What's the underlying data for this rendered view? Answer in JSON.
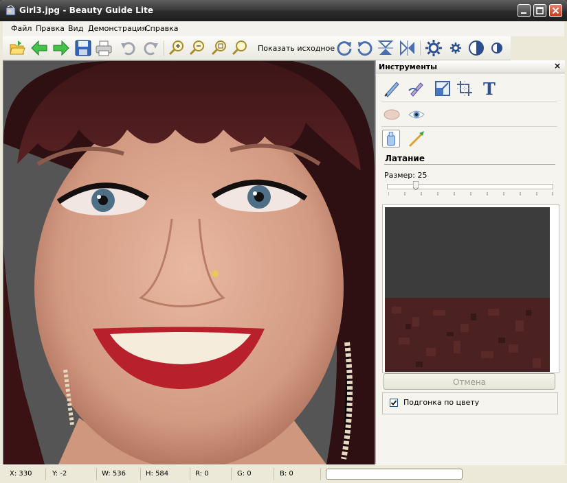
{
  "window": {
    "title": "Girl3.jpg - Beauty Guide Lite"
  },
  "menu": {
    "items": [
      "Файл",
      "Правка",
      "Вид",
      "Демонстрация",
      "Справка"
    ]
  },
  "toolbar": {
    "show_original_label": "Показать исходное"
  },
  "panel": {
    "title": "Инструменты",
    "close_label": "×",
    "text_tool_glyph": "T",
    "current_tool": "Латание",
    "size_label": "Размер: 25",
    "size_value": 25,
    "cancel_label": "Отмена",
    "color_match_label": "Подгонка по цвету",
    "color_match_checked": true
  },
  "status": {
    "x": "X: 330",
    "y": "Y: -2",
    "w": "W: 536",
    "h": "H: 584",
    "r": "R: 0",
    "g": "G: 0",
    "b": "B: 0"
  },
  "icons": [
    "open-icon",
    "back-icon",
    "forward-icon",
    "save-icon",
    "print-icon",
    "undo-icon",
    "redo-icon",
    "zoom-in-icon",
    "zoom-out-icon",
    "zoom-fit-icon",
    "zoom-actual-icon",
    "rotate-cw-icon",
    "rotate-ccw-icon",
    "flip-vertical-icon",
    "flip-horizontal-icon",
    "brightness-up-icon",
    "brightness-down-icon",
    "contrast-up-icon",
    "contrast-down-icon"
  ]
}
